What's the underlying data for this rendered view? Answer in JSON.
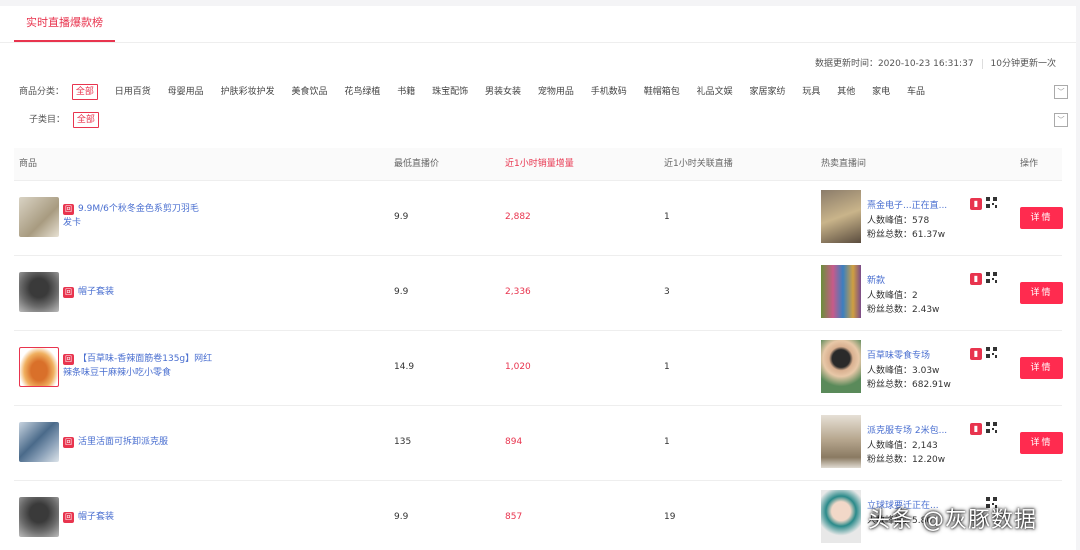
{
  "tabs": {
    "active": "实时直播爆款榜"
  },
  "update": {
    "label": "数据更新时间：",
    "time": "2020-10-23 16:31:37",
    "interval": "10分钟更新一次"
  },
  "filters": {
    "category_label": "商品分类：",
    "categories": [
      "全部",
      "日用百货",
      "母婴用品",
      "护肤彩妆护发",
      "美食饮品",
      "花鸟绿植",
      "书籍",
      "珠宝配饰",
      "男装女装",
      "宠物用品",
      "手机数码",
      "鞋帽箱包",
      "礼品文娱",
      "家居家纺",
      "玩具",
      "其他",
      "家电",
      "车品"
    ],
    "sub_label": "子类目：",
    "sub_selected": "全部"
  },
  "table": {
    "headers": [
      "商品",
      "最低直播价",
      "近1小时销量增量",
      "近1小时关联直播",
      "热卖直播间",
      "操作"
    ],
    "live_tag": "回",
    "people_label": "人数峰值：",
    "fans_label": "粉丝总数：",
    "detail_label": "详情",
    "rows": [
      {
        "name": "9.9M/6个秋冬金色系剪刀羽毛发卡",
        "price": "9.9",
        "sales": "2,882",
        "related": "1",
        "room": "熹金电子...正在直...",
        "peak": "578",
        "fans": "61.37w"
      },
      {
        "name": "帽子套装",
        "price": "9.9",
        "sales": "2,336",
        "related": "3",
        "room": "新款",
        "peak": "2",
        "fans": "2.43w"
      },
      {
        "name": "【百草味-香辣面筋卷135g】网红辣条味豆干麻辣小吃小零食",
        "price": "14.9",
        "sales": "1,020",
        "related": "1",
        "room": "百草味零食专场",
        "peak": "3.03w",
        "fans": "682.91w"
      },
      {
        "name": "活里活面可拆卸派克服",
        "price": "135",
        "sales": "894",
        "related": "1",
        "room": "派克服专场 2米包...",
        "peak": "2,143",
        "fans": "12.20w"
      },
      {
        "name": "帽子套装",
        "price": "9.9",
        "sales": "857",
        "related": "19",
        "room": "立球球要迁正在...",
        "peak": "5.80",
        "fans": ""
      }
    ]
  },
  "watermark": "头条 @灰豚数据"
}
